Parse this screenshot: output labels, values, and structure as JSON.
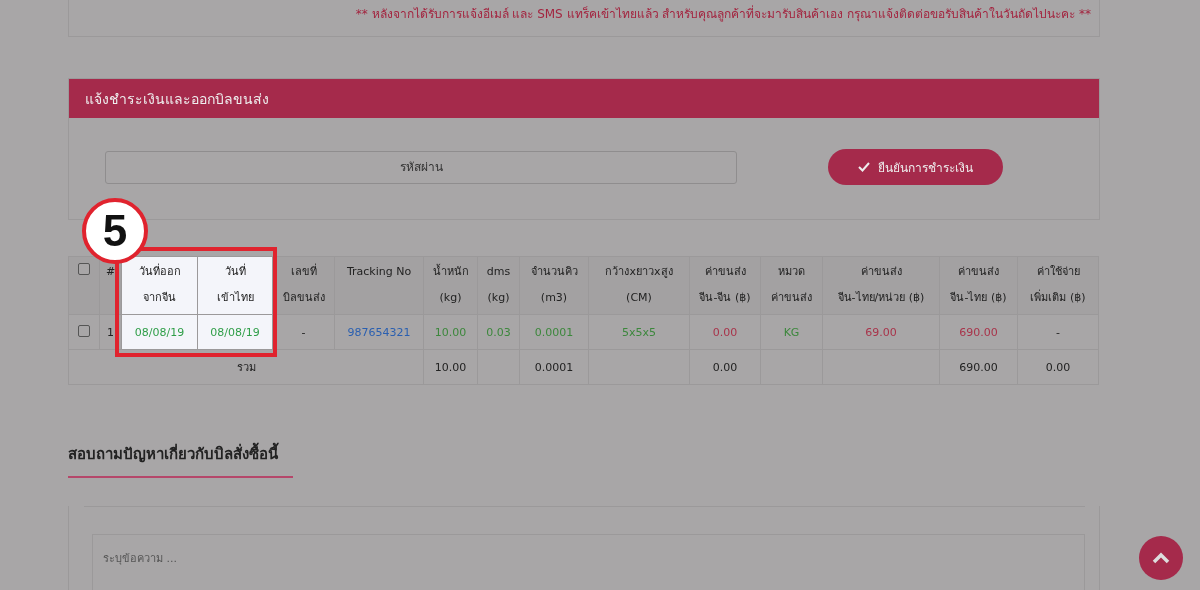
{
  "notice": "** หลังจากได้รับการแจ้งอีเมล์ และ SMS แทร็คเข้าไทยแล้ว สำหรับคุณลูกค้าที่จะมารับสินค้าเอง กรุณาแจ้งติดต่อขอรับสินค้าในวันถัดไปนะคะ **",
  "payment": {
    "title": "แจ้งชำระเงินและออกบิลขนส่ง",
    "password": {
      "placeholder": "รหัสผ่าน"
    },
    "confirm_button": "ยืนยันการชำระเงิน"
  },
  "callout": {
    "number": "5"
  },
  "table": {
    "columns": [
      {
        "kind": "checkbox",
        "checked": false,
        "highlighted": false
      },
      {
        "kind": "text",
        "label": "#",
        "highlighted": false
      },
      {
        "kind": "text",
        "label": "วันที่ออก\nจากจีน",
        "highlighted": true
      },
      {
        "kind": "text",
        "label": "วันที่\nเข้าไทย",
        "highlighted": true
      },
      {
        "kind": "text",
        "label": "เลขที่\nบิลขนส่ง",
        "highlighted": false
      },
      {
        "kind": "text",
        "label": "Tracking No",
        "highlighted": false
      },
      {
        "kind": "text",
        "label": "น้ำหนัก\n(kg)",
        "highlighted": false
      },
      {
        "kind": "text",
        "label": "dms\n(kg)",
        "highlighted": false
      },
      {
        "kind": "text",
        "label": "จำนวนคิว\n(m3)",
        "highlighted": false
      },
      {
        "kind": "text",
        "label": "กว้างxยาวxสูง\n(CM)",
        "highlighted": false
      },
      {
        "kind": "text",
        "label": "ค่าขนส่ง\nจีน-จีน (฿)",
        "highlighted": false
      },
      {
        "kind": "text",
        "label": "หมวด\nค่าขนส่ง",
        "highlighted": false
      },
      {
        "kind": "text",
        "label": "ค่าขนส่ง\nจีน-ไทย/หน่วย (฿)",
        "highlighted": false
      },
      {
        "kind": "text",
        "label": "ค่าขนส่ง\nจีน-ไทย (฿)",
        "highlighted": false
      },
      {
        "kind": "text",
        "label": "ค่าใช้จ่าย\nเพิ่มเติม (฿)",
        "highlighted": false
      }
    ],
    "rows": [
      {
        "cells": [
          {
            "kind": "checkbox",
            "checked": false
          },
          {
            "kind": "text",
            "text": "1"
          },
          {
            "kind": "text",
            "text": "08/08/19",
            "color": "#2f9e48"
          },
          {
            "kind": "text",
            "text": "08/08/19",
            "color": "#2f9e48"
          },
          {
            "kind": "text",
            "text": "-"
          },
          {
            "kind": "link",
            "text": "987654321",
            "color": "#2a5fb0"
          },
          {
            "kind": "text",
            "text": "10.00",
            "color": "#3c873c"
          },
          {
            "kind": "text",
            "text": "0.03",
            "color": "#3c873c"
          },
          {
            "kind": "text",
            "text": "0.0001",
            "color": "#3c873c"
          },
          {
            "kind": "text",
            "text": "5x5x5",
            "color": "#3c873c"
          },
          {
            "kind": "text",
            "text": "0.00",
            "color": "#a8334a"
          },
          {
            "kind": "text",
            "text": "KG",
            "color": "#3c873c"
          },
          {
            "kind": "text",
            "text": "69.00",
            "color": "#a8334a"
          },
          {
            "kind": "text",
            "text": "690.00",
            "color": "#a8334a"
          },
          {
            "kind": "text",
            "text": "-"
          }
        ]
      }
    ],
    "total": {
      "cells": [
        {
          "text": "รวม",
          "kind": "label"
        },
        {
          "text": "10.00"
        },
        {
          "text": ""
        },
        {
          "text": "0.0001"
        },
        {
          "text": ""
        },
        {
          "text": "0.00"
        },
        {
          "text": ""
        },
        {
          "text": ""
        },
        {
          "text": "690.00"
        },
        {
          "text": "0.00"
        }
      ]
    }
  },
  "inquiry": {
    "title": "สอบถามปัญหาเกี่ยวกับบิลสั่งซื้อนี้",
    "message": {
      "placeholder": "ระบุข้อความ ..."
    }
  }
}
